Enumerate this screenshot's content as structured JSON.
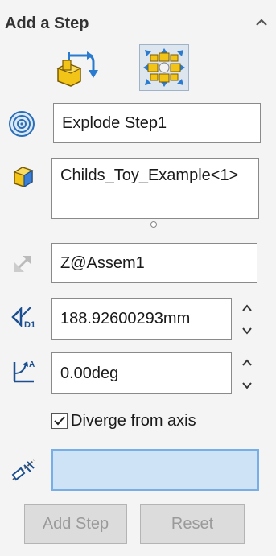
{
  "header": {
    "title": "Add a Step"
  },
  "step_name": {
    "value": "Explode Step1"
  },
  "components": {
    "items": [
      "Childs_Toy_Example<1>"
    ]
  },
  "direction": {
    "value": "Z@Assem1"
  },
  "distance": {
    "value": "188.92600293mm"
  },
  "rotation": {
    "value": "0.00deg"
  },
  "diverge": {
    "label": "Diverge from axis",
    "checked": true
  },
  "buttons": {
    "add_step": "Add Step",
    "reset": "Reset"
  },
  "colors": {
    "accent": "#3a86d8",
    "selection_bg": "#cfe3f7",
    "component_yellow": "#f2c418",
    "component_blue": "#3a7fd5"
  }
}
